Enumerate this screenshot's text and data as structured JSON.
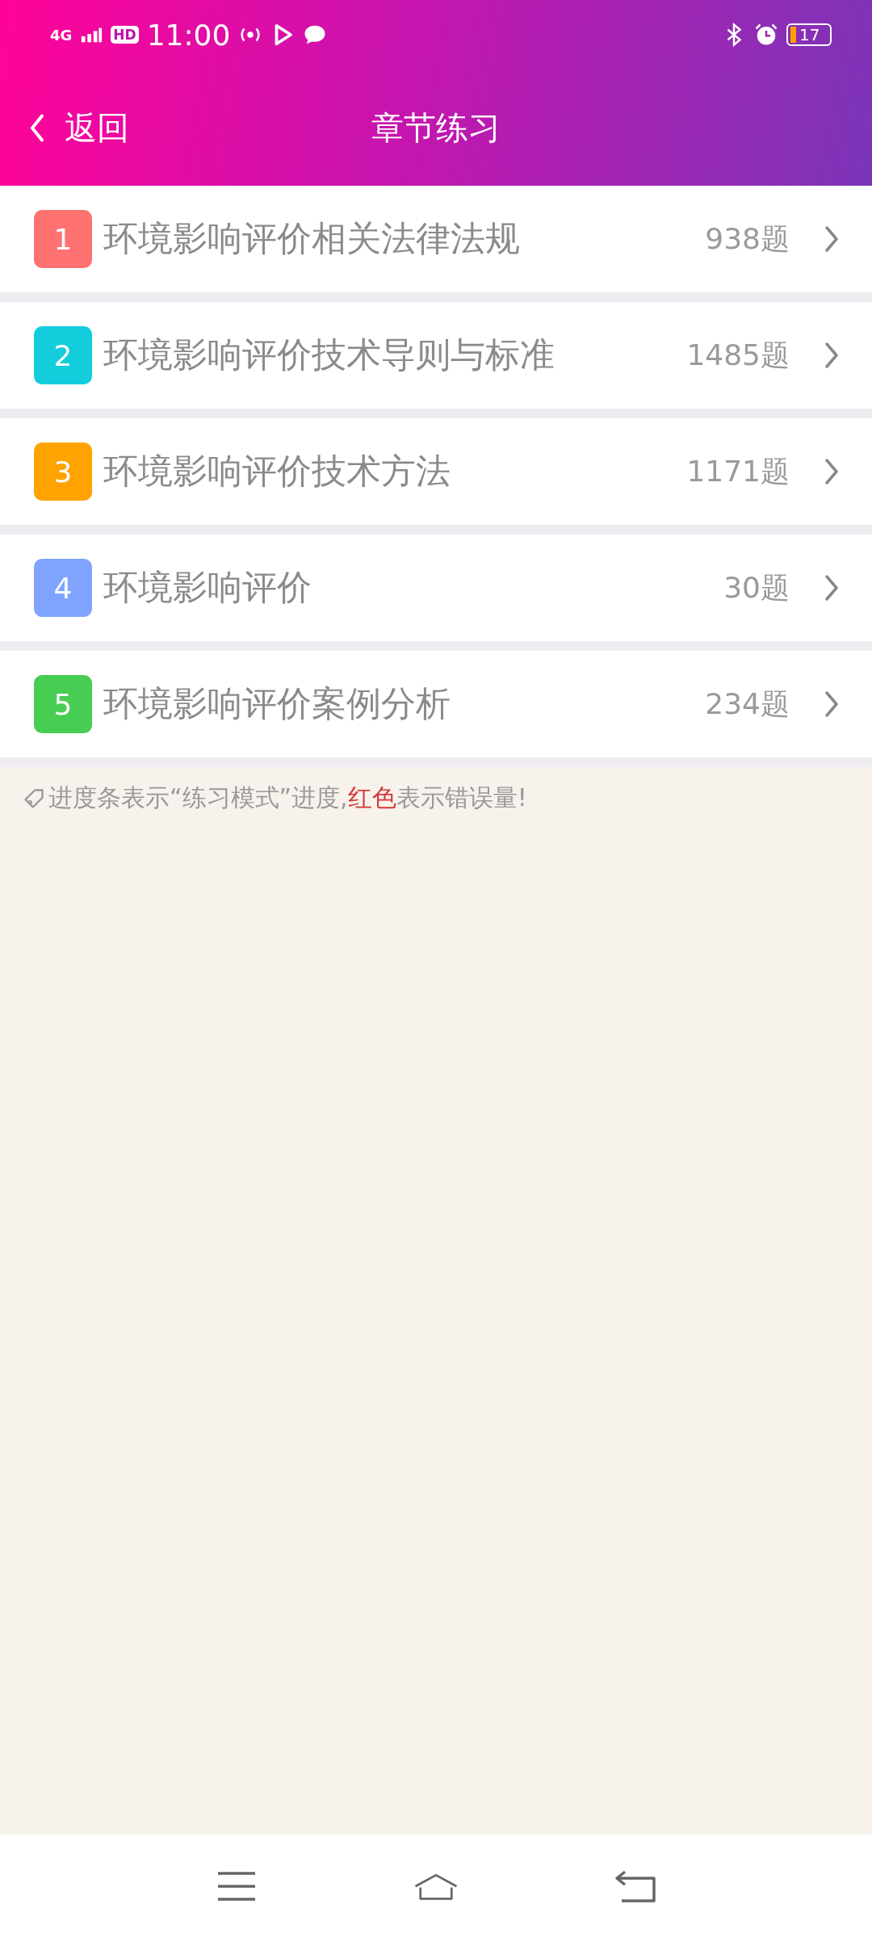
{
  "status_bar": {
    "network": "4G",
    "hd": "HD",
    "time": "11:00",
    "battery": "17"
  },
  "header": {
    "back_label": "返回",
    "title": "章节练习"
  },
  "chapters": [
    {
      "number": "1",
      "title": "环境影响评价相关法律法规",
      "count": "938题",
      "color": "#ff7272"
    },
    {
      "number": "2",
      "title": "环境影响评价技术导则与标准",
      "count": "1485题",
      "color": "#13cddc"
    },
    {
      "number": "3",
      "title": "环境影响评价技术方法",
      "count": "1171题",
      "color": "#ffa300"
    },
    {
      "number": "4",
      "title": "环境影响评价",
      "count": "30题",
      "color": "#7fa3ff"
    },
    {
      "number": "5",
      "title": "环境影响评价案例分析",
      "count": "234题",
      "color": "#46cd52"
    }
  ],
  "note": [
    {
      "kind": "plain",
      "text": "进度条表示“练习模式”进度,"
    },
    {
      "kind": "red",
      "text": "红色"
    },
    {
      "kind": "plain",
      "text": "表示错误量!"
    }
  ]
}
